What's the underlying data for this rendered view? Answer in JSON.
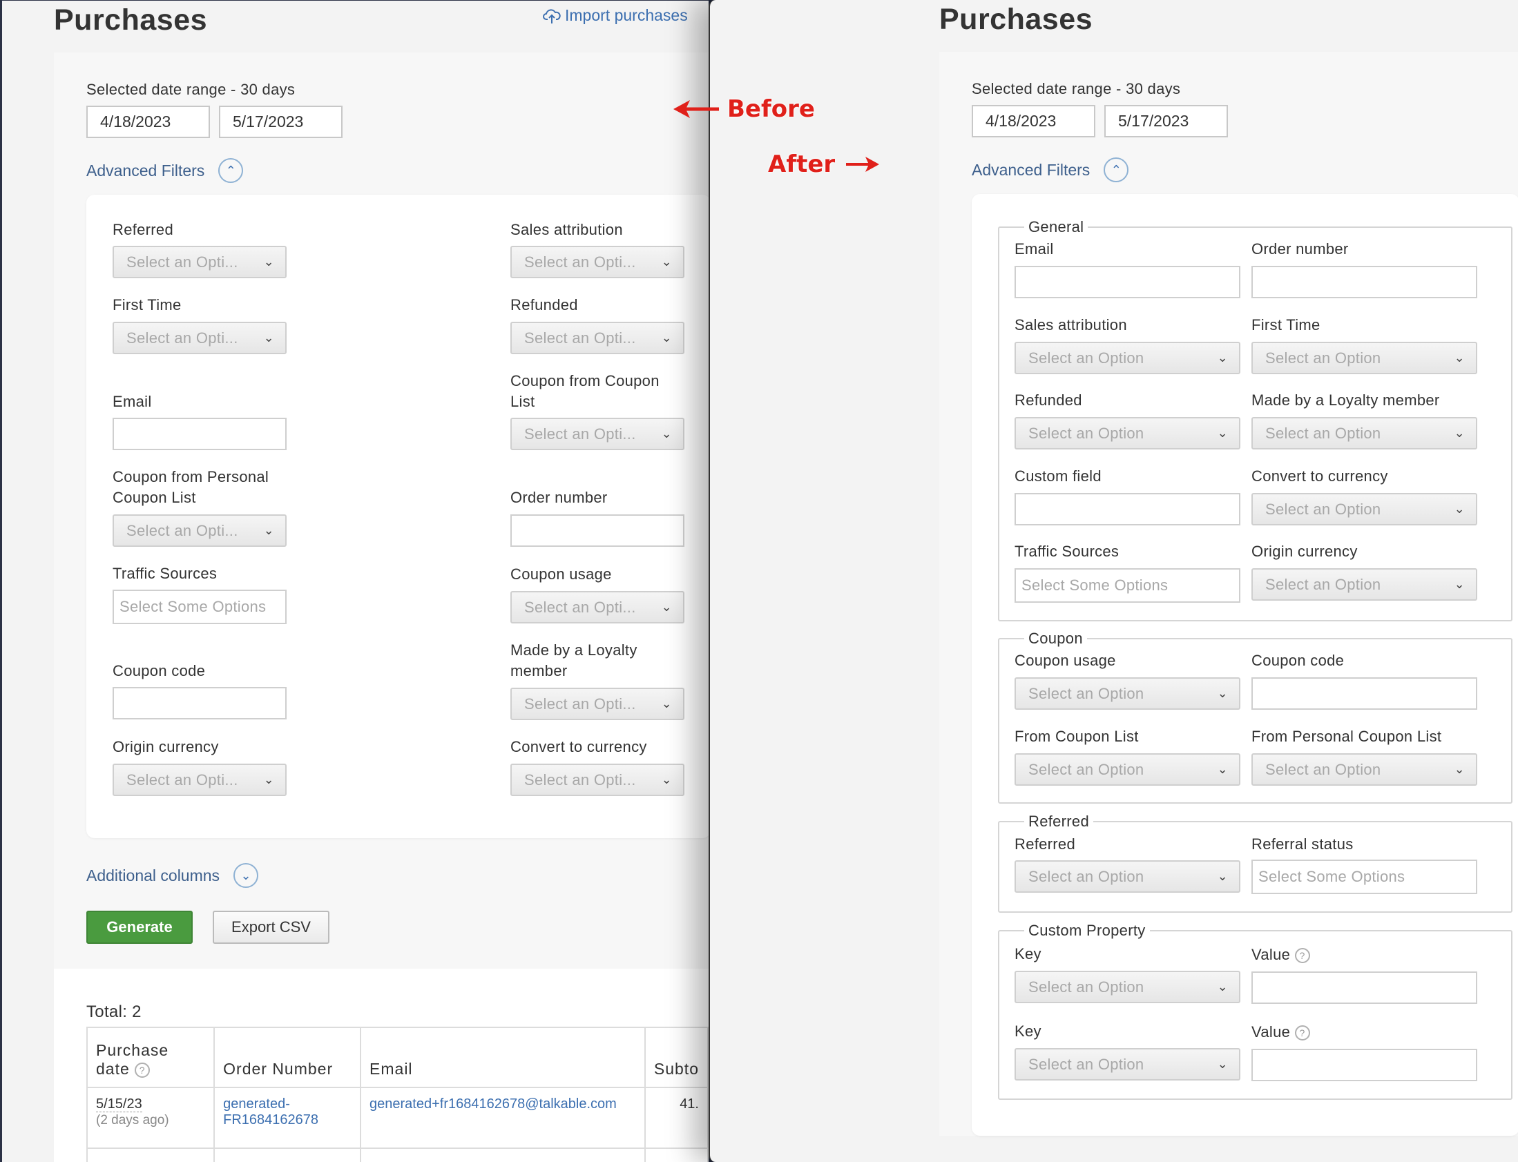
{
  "page_title": "Purchases",
  "import_label": "Import purchases",
  "date_range_label": "Selected date range - 30 days",
  "date_start": "4/18/2023",
  "date_end": "5/17/2023",
  "advanced_filters_label": "Advanced Filters",
  "placeholder_short": "Select an Opti...",
  "placeholder_select": "Select an Option",
  "placeholder_multi": "Select Some Options",
  "annotations": {
    "before": "Before",
    "after": "After"
  },
  "before": {
    "labels": {
      "referred": "Referred",
      "sales_attribution": "Sales attribution",
      "first_time": "First Time",
      "refunded": "Refunded",
      "coupon_from_list_1": "Coupon from Coupon",
      "coupon_from_list_2": "List",
      "email": "Email",
      "personal_coupon_1": "Coupon from Personal",
      "personal_coupon_2": "Coupon List",
      "order_number": "Order number",
      "traffic_sources": "Traffic Sources",
      "coupon_usage": "Coupon usage",
      "loyalty_1": "Made by a Loyalty",
      "loyalty_2": "member",
      "coupon_code": "Coupon code",
      "origin_currency": "Origin currency",
      "convert_currency": "Convert to currency"
    },
    "additional_columns": "Additional columns",
    "generate": "Generate",
    "export_csv": "Export CSV",
    "total": "Total: 2",
    "table": {
      "headers": {
        "purchase_1": "Purchase",
        "purchase_2": "date",
        "order": "Order Number",
        "email": "Email",
        "subtotal": "Subto"
      },
      "row1": {
        "date": "5/15/23",
        "ago": "(2 days ago)",
        "order_1": "generated-",
        "order_2": "FR1684162678",
        "email": "generated+fr1684162678@talkable.com",
        "subtotal": "41."
      }
    }
  },
  "after": {
    "groups": {
      "general": "General",
      "coupon": "Coupon",
      "referred": "Referred",
      "custom": "Custom Property"
    },
    "labels": {
      "email": "Email",
      "order_number": "Order number",
      "sales_attribution": "Sales attribution",
      "first_time": "First Time",
      "refunded": "Refunded",
      "loyalty": "Made by a Loyalty member",
      "custom_field": "Custom field",
      "convert_currency": "Convert to currency",
      "traffic_sources": "Traffic Sources",
      "origin_currency": "Origin currency",
      "coupon_usage": "Coupon usage",
      "coupon_code": "Coupon code",
      "from_coupon_list": "From Coupon List",
      "from_personal_list": "From Personal Coupon List",
      "referred": "Referred",
      "referral_status": "Referral status",
      "key": "Key",
      "value": "Value"
    }
  }
}
